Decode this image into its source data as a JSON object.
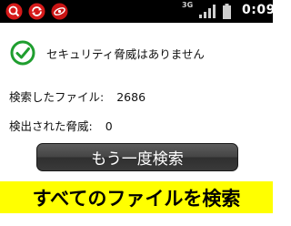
{
  "status_bar": {
    "network": "3G",
    "time": "0:09"
  },
  "scan_result": {
    "message": "セキュリティ脅威はありません",
    "files_scanned_label": "検索したファイル:",
    "files_scanned_value": "2686",
    "threats_detected_label": "検出された脅威:",
    "threats_detected_value": "0"
  },
  "actions": {
    "rescan_label": "もう一度検索"
  },
  "caption": {
    "text": "すべてのファイルを検索"
  },
  "colors": {
    "check_green": "#1f9e2f",
    "caption_bg": "#ffff00",
    "status_bar_bg": "#000000"
  }
}
